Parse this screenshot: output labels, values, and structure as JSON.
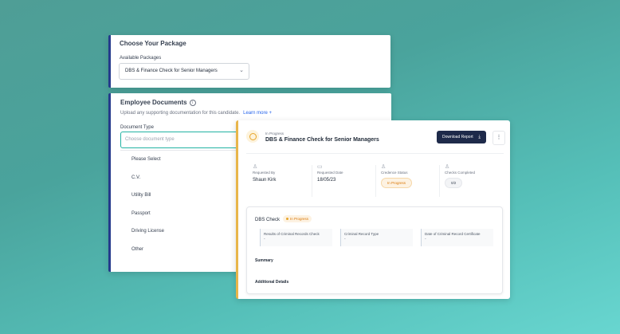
{
  "package_card": {
    "title": "Choose Your Package",
    "label": "Available Packages",
    "selected": "DBS & Finance Check for Senior Managers"
  },
  "documents_card": {
    "title": "Employee Documents",
    "description": "Upload any supporting documentation for this candidate.",
    "learn_more": "Learn more",
    "doc_type_label": "Document Type",
    "doc_type_placeholder": "Choose document type",
    "options": [
      "Please Select",
      "C.V.",
      "Utility Bill",
      "Passport",
      "Driving License",
      "Other"
    ]
  },
  "progress_card": {
    "status": "In Progress",
    "title": "DBS & Finance Check for Senior Managers",
    "download_label": "Download Report",
    "requested_by": {
      "label": "Requested By",
      "value": "Shaun Kirk"
    },
    "requested_date": {
      "label": "Requested Date",
      "value": "18/05/23"
    },
    "credence_status": {
      "label": "Credence Status",
      "value": "In Progress"
    },
    "checks_completed": {
      "label": "Checks Completed",
      "value": "0/2"
    },
    "dbs": {
      "title": "DBS Check",
      "badge": "In Progress",
      "cols": [
        {
          "label": "Results of Criminal Records Check",
          "value": "-"
        },
        {
          "label": "Criminal Record Type",
          "value": "-"
        },
        {
          "label": "Date of Criminal Record Certificate",
          "value": "-"
        }
      ],
      "summary": "Summary",
      "additional": "Additional Details"
    }
  },
  "colors": {
    "accent_blue": "#253a8c",
    "accent_gold": "#e8b54a",
    "button_dark": "#1e2a4a"
  }
}
